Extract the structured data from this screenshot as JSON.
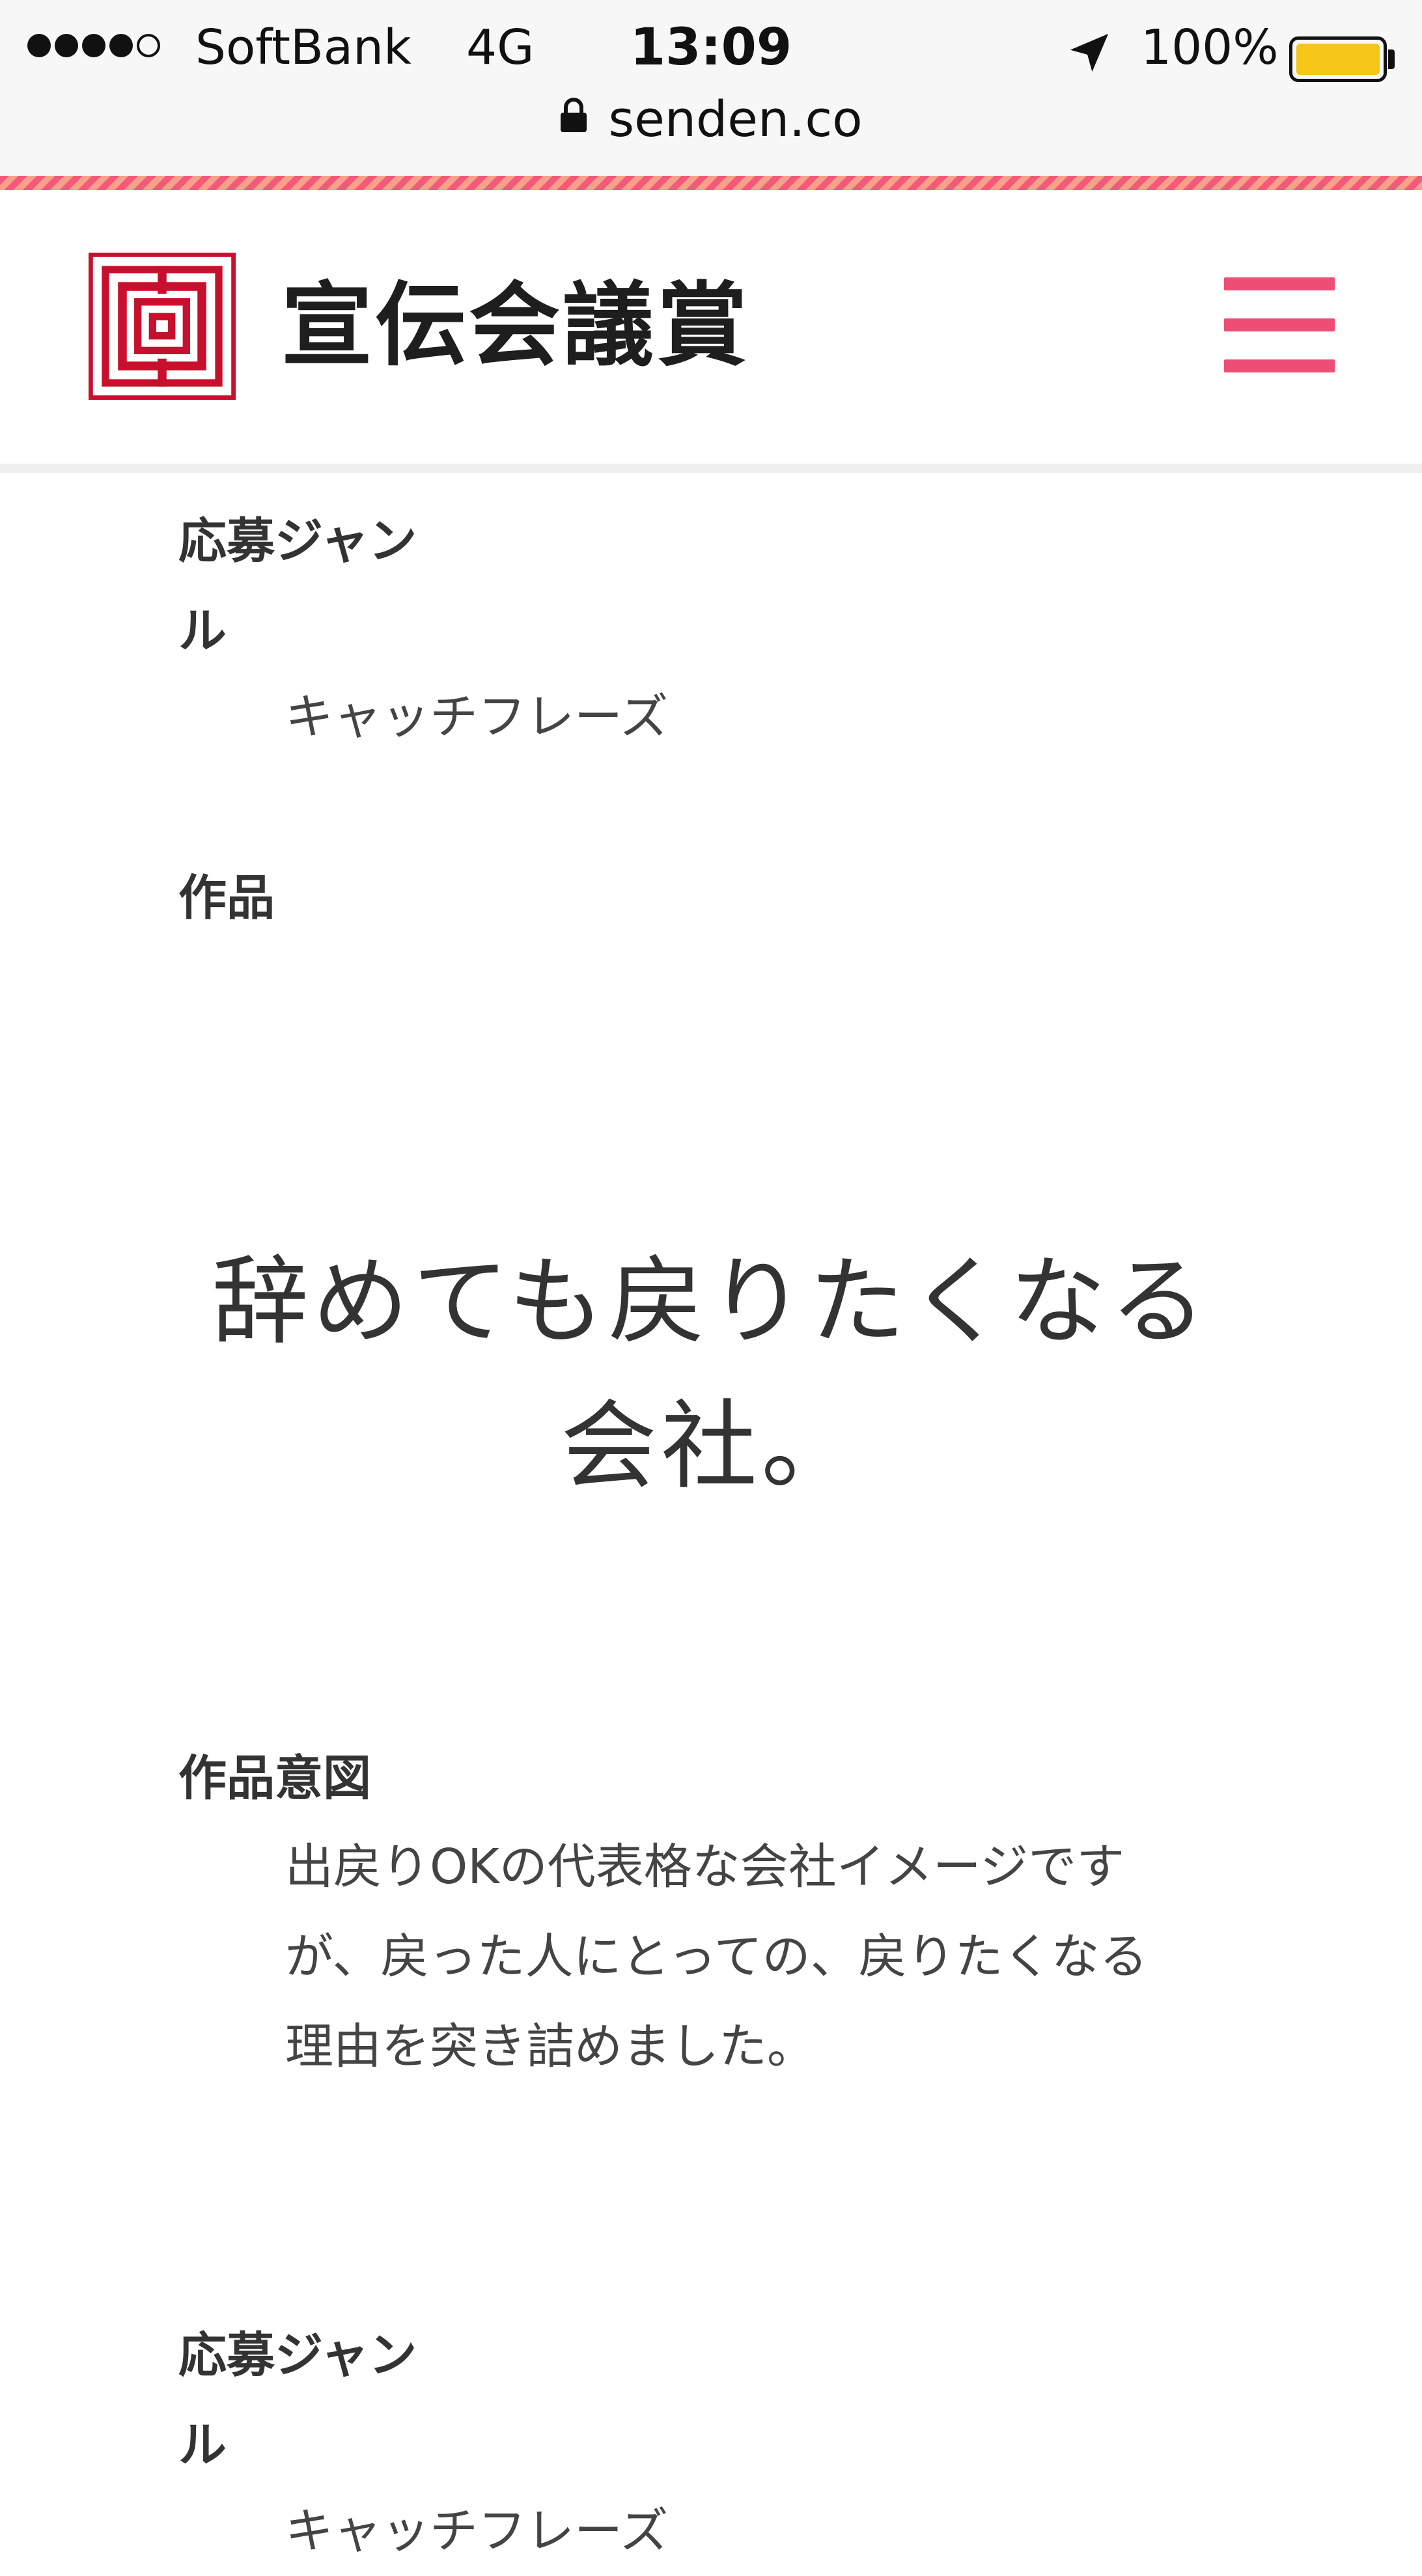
{
  "status_bar": {
    "carrier": "SoftBank",
    "network": "4G",
    "time": "13:09",
    "battery": "100%",
    "battery_level": 1.0,
    "url": "senden.co"
  },
  "header": {
    "site_title": "宣伝会議賞",
    "menu_icon": "hamburger-menu-icon",
    "accent_color": "#ee4d76",
    "logo_color": "#c8102e"
  },
  "entries": [
    {
      "genre_label_line1": "応募ジャン",
      "genre_label_line2": "ル",
      "genre_value": "キャッチフレーズ",
      "work_label": "作品",
      "work_text_line1": "辞めても戻りたくなる",
      "work_text_line2": "会社。",
      "intent_label": "作品意図",
      "intent_line1": "出戻りOKの代表格な会社イメージです",
      "intent_line2": "が、戻った人にとっての、戻りたくなる",
      "intent_line3": "理由を突き詰めました。"
    },
    {
      "genre_label_line1": "応募ジャン",
      "genre_label_line2": "ル",
      "genre_value": "キャッチフレーズ"
    }
  ]
}
